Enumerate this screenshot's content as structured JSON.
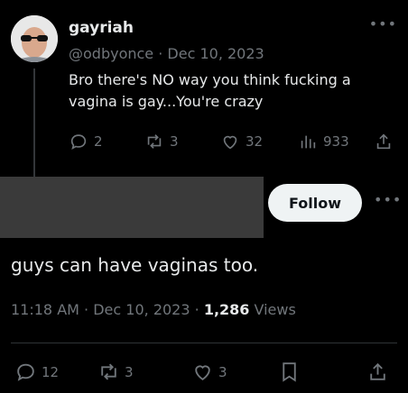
{
  "tweet1": {
    "display_name": "gayriah",
    "handle": "@odbyonce",
    "separator": "·",
    "date": "Dec 10, 2023",
    "more_icon": "ellipsis-icon",
    "text": "Bro there's NO way you think fucking a vagina is gay...You're crazy",
    "actions": {
      "replies": "2",
      "reposts": "3",
      "likes": "32",
      "views": "933"
    }
  },
  "tweet2": {
    "follow_label": "Follow",
    "more_icon": "ellipsis-icon",
    "text": "guys can have vaginas too.",
    "time": "11:18 AM",
    "sep": "·",
    "date": "Dec 10, 2023",
    "views_count": "1,286",
    "views_label": "Views",
    "actions": {
      "replies": "12",
      "reposts": "3",
      "likes": "3"
    }
  },
  "colors": {
    "background": "#000000",
    "text": "#e7e9ea",
    "muted": "#71767b",
    "follow_bg": "#eff3f4"
  }
}
